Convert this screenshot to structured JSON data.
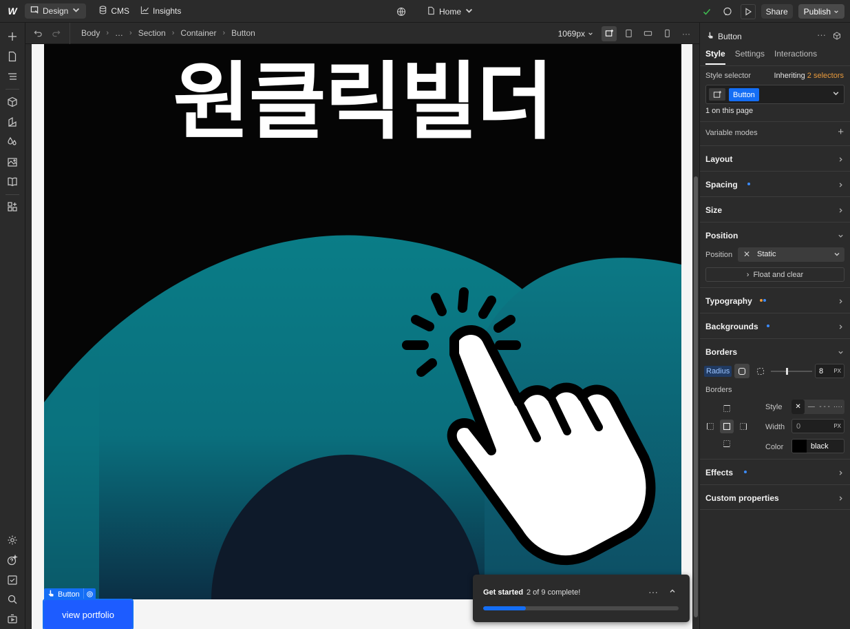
{
  "topbar": {
    "logo": "W",
    "design_label": "Design",
    "cms_label": "CMS",
    "insights_label": "Insights",
    "page_label": "Home",
    "share_label": "Share",
    "publish_label": "Publish"
  },
  "breadcrumb": {
    "items": [
      "Body",
      "…",
      "Section",
      "Container",
      "Button"
    ],
    "viewport_size": "1069px"
  },
  "canvas": {
    "hero_title": "원클릭빌더",
    "hero_colors": {
      "background": "#050505",
      "wave": "#0b7a85",
      "hand": "#ffffff"
    },
    "selected_tag": "Button",
    "button_text": "view portfolio",
    "button_color": "#1d5cff"
  },
  "getting_started": {
    "title": "Get started",
    "count": "2 of 9 complete!",
    "progress": 0.22
  },
  "panel": {
    "element_name": "Button",
    "tabs": [
      "Style",
      "Settings",
      "Interactions"
    ],
    "style_selector_label": "Style selector",
    "inheriting_prefix": "Inheriting",
    "inheriting_count": "2 selectors",
    "selector_chip": "Button",
    "on_page": "1 on this page",
    "variable_modes": "Variable modes",
    "sections": {
      "layout": "Layout",
      "spacing": "Spacing",
      "size": "Size",
      "position": "Position",
      "typography": "Typography",
      "backgrounds": "Backgrounds",
      "borders": "Borders",
      "effects": "Effects",
      "custom_properties": "Custom properties"
    },
    "position": {
      "label": "Position",
      "value": "Static",
      "float_clear": "Float and clear"
    },
    "borders": {
      "radius_label": "Radius",
      "radius_value": "8",
      "radius_unit": "PX",
      "borders_label": "Borders",
      "style_label": "Style",
      "width_label": "Width",
      "width_value": "0",
      "width_unit": "PX",
      "color_label": "Color",
      "color_value": "black"
    }
  }
}
